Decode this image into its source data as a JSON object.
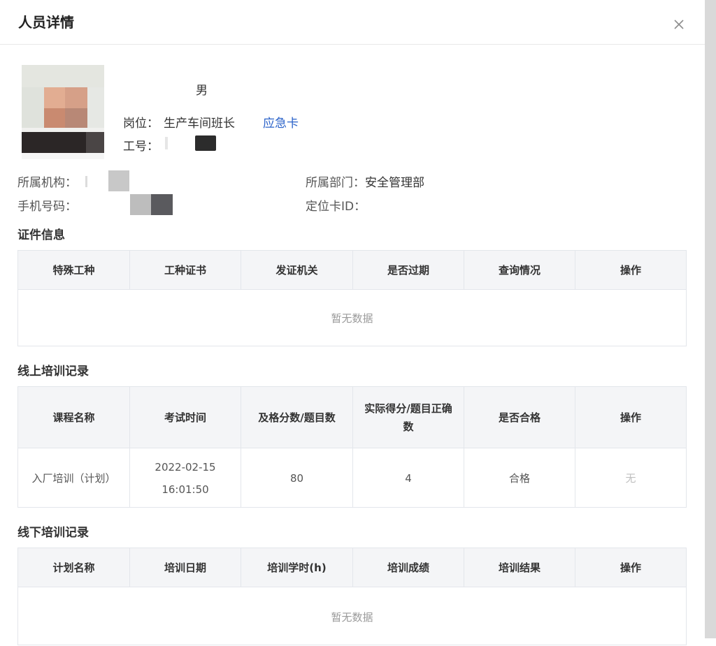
{
  "dialog": {
    "title": "人员详情"
  },
  "person": {
    "gender": "男",
    "position_label": "岗位：",
    "position_value": "生产车间班长",
    "emergency_link": "应急卡",
    "jobno_label": "工号："
  },
  "fields": {
    "org_label": "所属机构：",
    "dept_label": "所属部门：",
    "dept_value": "安全管理部",
    "phone_label": "手机号码：",
    "locator_label": "定位卡ID："
  },
  "cert_section": {
    "title": "证件信息",
    "columns": [
      "特殊工种",
      "工种证书",
      "发证机关",
      "是否过期",
      "查询情况",
      "操作"
    ],
    "empty_text": "暂无数据"
  },
  "online_section": {
    "title": "线上培训记录",
    "columns": [
      "课程名称",
      "考试时间",
      "及格分数/题目数",
      "实际得分/题目正确数",
      "是否合格",
      "操作"
    ],
    "rows": [
      [
        "入厂培训（计划）",
        "2022-02-15 16:01:50",
        "80",
        "4",
        "合格",
        "无"
      ]
    ]
  },
  "offline_section": {
    "title": "线下培训记录",
    "columns": [
      "计划名称",
      "培训日期",
      "培训学时(h)",
      "培训成绩",
      "培训结果",
      "操作"
    ],
    "empty_text": "暂无数据"
  },
  "colors": {
    "link": "#2a62c9",
    "header_bg": "#f4f5f7",
    "border": "#e3e6eb"
  },
  "icons": {
    "close": "close-icon"
  }
}
